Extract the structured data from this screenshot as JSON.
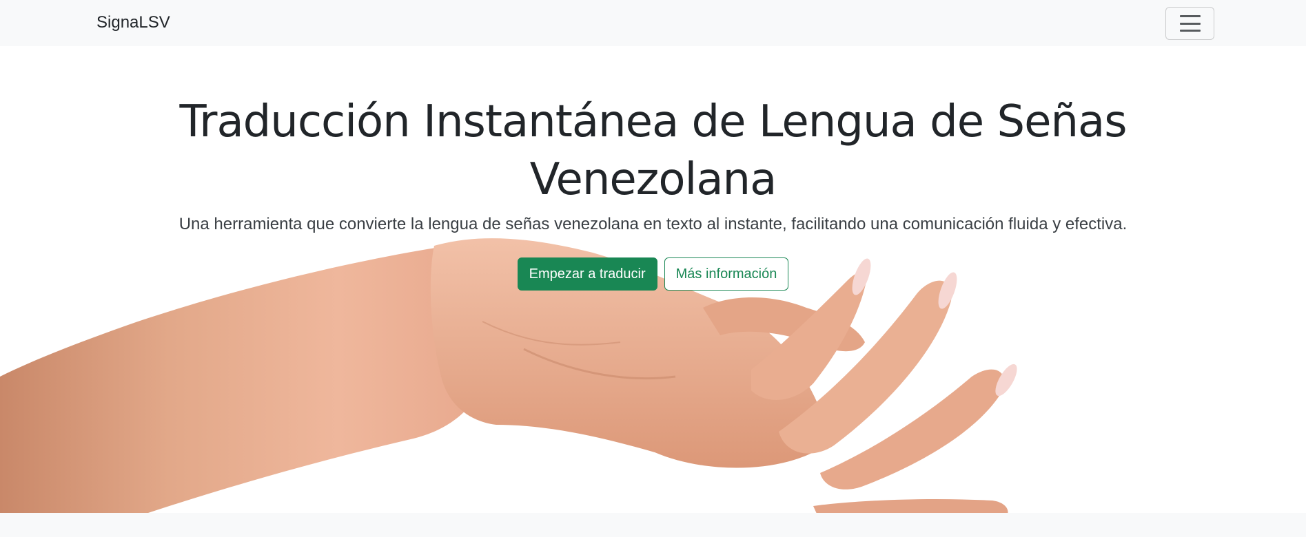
{
  "navbar": {
    "brand": "SignaLSV",
    "toggler_icon": "hamburger-menu-icon"
  },
  "hero": {
    "title": "Traducción Instantánea de Lengua de Señas Venezolana",
    "lead": "Una herramienta que convierte la lengua de señas venezolana en texto al instante, facilitando una comunicación fluida y efectiva.",
    "primary_button": "Empezar a traducir",
    "secondary_button": "Más información",
    "background_image": "open-hand-illustration"
  },
  "colors": {
    "accent": "#198754",
    "navbar_bg": "#f8f9fa",
    "text": "#212529"
  }
}
